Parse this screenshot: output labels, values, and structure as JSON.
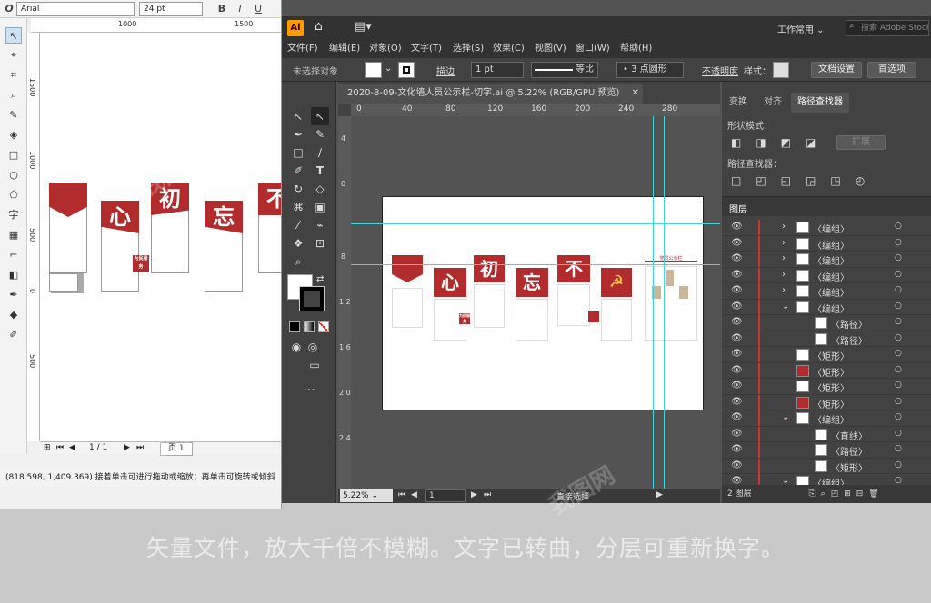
{
  "corel": {
    "font_name": "Arial",
    "font_size": "24 pt",
    "ruler_h": [
      "1000",
      "1500"
    ],
    "ruler_v": [
      "1500",
      "1000",
      "500",
      "0",
      "500"
    ],
    "page_counter": "1 / 1",
    "page_tab": "页 1",
    "status": "(818.598, 1,409.369) 接着单击可进行拖动或缩放；再单击可旋转或倾斜"
  },
  "ai": {
    "app_icon": "Ai",
    "workspace": "工作常用",
    "search_placeholder": "搜索 Adobe Stock",
    "menu": [
      "文件(F)",
      "编辑(E)",
      "对象(O)",
      "文字(T)",
      "选择(S)",
      "效果(C)",
      "视图(V)",
      "窗口(W)",
      "帮助(H)"
    ],
    "control": {
      "no_selection": "未选择对象",
      "stroke_label": "描边",
      "stroke_value": "1 pt",
      "stroke_profile": "等比",
      "brush": "3 点圆形",
      "opacity_label": "不透明度",
      "style_label": "样式：",
      "doc_setup": "文档设置",
      "preferences": "首选项"
    },
    "doc_tab": "2020-8-09-文化墙人员公示栏-切字.ai @ 5.22% (RGB/GPU 预览)",
    "ruler_h": [
      "0",
      "40",
      "80",
      "120",
      "160",
      "200",
      "240",
      "280"
    ],
    "ruler_v": [
      "4",
      "0",
      "8",
      "1 2",
      "1 6",
      "2 0",
      "2 4"
    ],
    "zoom": "5.22%",
    "artboard_num": "1",
    "status_tool": "直接选择",
    "panel_tabs": [
      "变换",
      "对齐",
      "路径查找器"
    ],
    "shape_modes_label": "形状模式：",
    "expand_label": "扩展",
    "pathfinder_label": "路径查找器：",
    "layers_tab": "图层",
    "layers": [
      {
        "name": "〈编组〉",
        "indent": 0,
        "expand": "›"
      },
      {
        "name": "〈编组〉",
        "indent": 0,
        "expand": "›"
      },
      {
        "name": "〈编组〉",
        "indent": 0,
        "expand": "›"
      },
      {
        "name": "〈编组〉",
        "indent": 0,
        "expand": "›"
      },
      {
        "name": "〈编组〉",
        "indent": 0,
        "expand": "›"
      },
      {
        "name": "〈编组〉",
        "indent": 0,
        "expand": "⌄"
      },
      {
        "name": "〈路径〉",
        "indent": 1,
        "expand": ""
      },
      {
        "name": "〈路径〉",
        "indent": 1,
        "expand": ""
      },
      {
        "name": "〈矩形〉",
        "indent": 0,
        "expand": ""
      },
      {
        "name": "〈矩形〉",
        "indent": 0,
        "expand": ""
      },
      {
        "name": "〈矩形〉",
        "indent": 0,
        "expand": ""
      },
      {
        "name": "〈矩形〉",
        "indent": 0,
        "expand": ""
      },
      {
        "name": "〈编组〉",
        "indent": 0,
        "expand": "⌄"
      },
      {
        "name": "〈直线〉",
        "indent": 1,
        "expand": ""
      },
      {
        "name": "〈路径〉",
        "indent": 1,
        "expand": ""
      },
      {
        "name": "〈矩形〉",
        "indent": 1,
        "expand": ""
      },
      {
        "name": "〈编组〉",
        "indent": 0,
        "expand": "⌄"
      }
    ],
    "layers_count": "2 图层"
  },
  "artwork": {
    "banner_chars": [
      "心",
      "初",
      "忘",
      "不"
    ],
    "small_box_text": "为民服务",
    "board_title": "党员公示栏"
  },
  "caption": "矢量文件，放大千倍不模糊。文字已转曲，分层可重新换字。",
  "colors": {
    "brand_red": "#b22c2e",
    "ai_dark": "#323232",
    "ai_panel": "#424242",
    "guide": "#3fd6e0"
  }
}
